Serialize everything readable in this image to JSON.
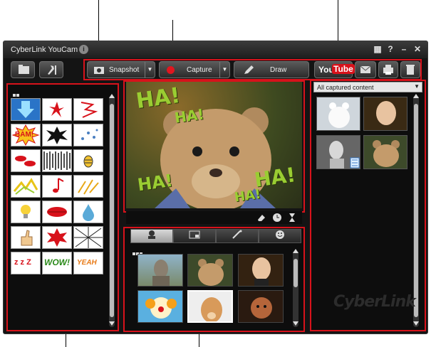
{
  "window": {
    "title": "CyberLink YouCam"
  },
  "toolbar": {
    "snapshot_label": "Snapshot",
    "capture_label": "Capture",
    "draw_label": "Draw",
    "youtube_label_you": "You",
    "youtube_label_tube": "Tube"
  },
  "captured": {
    "filter_value": "All captured content"
  },
  "preview": {
    "overlay_text": [
      "HA!",
      "HA!",
      "HA!",
      "HA!",
      "HA!"
    ]
  },
  "effects_bubbles": {
    "bam": "BAM!",
    "wow": "WOW!",
    "yeah": "YEAH",
    "zzz": "z z Z"
  },
  "branding": {
    "logo": "CyberLink"
  },
  "colors": {
    "accent_red": "#d8121b",
    "window_bg": "#141414",
    "selected_cell": "#2a74c7"
  }
}
